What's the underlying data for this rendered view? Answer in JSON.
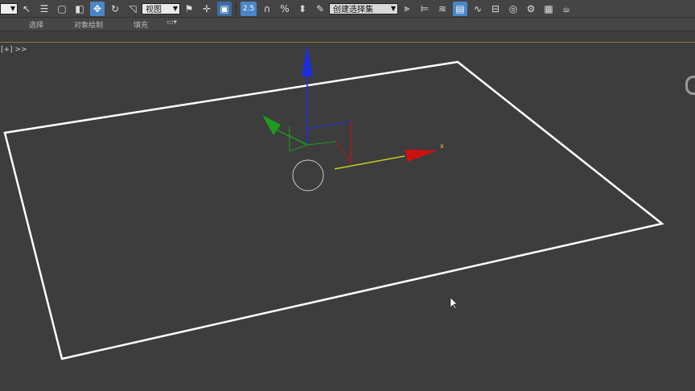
{
  "toolbar": {
    "view_dropdown": "视图",
    "named_selection": "创建选择集",
    "snap_label": "2.5",
    "icons": [
      "dropdown-arrow",
      "select-icon",
      "select-by-name-icon",
      "rect-region-icon",
      "window-crossing-icon",
      "move-icon",
      "rotate-icon",
      "scale-icon",
      "pin-icon",
      "use-pivot-icon",
      "snap-icon",
      "angle-snap-icon",
      "percent-snap-icon",
      "spinner-snap-icon",
      "edit-named-sel-icon",
      "mirror-icon",
      "align-icon",
      "layers-icon",
      "ribbon-toggle-icon",
      "curve-editor-icon",
      "schematic-icon",
      "material-editor-icon",
      "render-setup-icon",
      "render-frame-icon",
      "render-icon"
    ]
  },
  "ribbon": {
    "tabs": [
      "选择",
      "对象绘制",
      "填充"
    ]
  },
  "viewport": {
    "label": "[+] >>",
    "gizmo_x_label": "x",
    "colors": {
      "background": "#3d3d3d",
      "plane": "#ffffff",
      "axis_x": "#cc1111",
      "axis_y": "#1e9c1e",
      "axis_z": "#1a2ee0",
      "accent": "#b5952e"
    }
  }
}
